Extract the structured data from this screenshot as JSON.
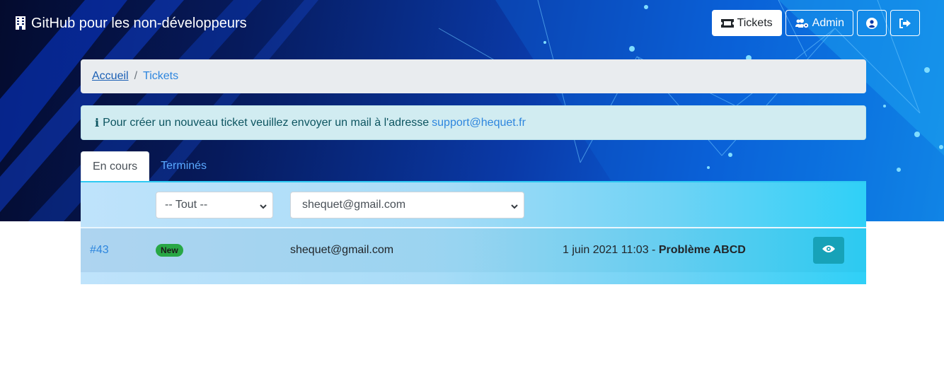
{
  "navbar": {
    "brand_text": "GitHub pour les non-développeurs",
    "tickets_label": "Tickets",
    "admin_label": "Admin"
  },
  "breadcrumb": {
    "home": "Accueil",
    "current": "Tickets"
  },
  "alert": {
    "text": "Pour créer un nouveau ticket veuillez envoyer un mail à l'adresse",
    "email": "support@hequet.fr"
  },
  "tabs": [
    {
      "label": "En cours",
      "active": true
    },
    {
      "label": "Terminés",
      "active": false
    }
  ],
  "filters": {
    "status_selected": "-- Tout --",
    "email_selected": "shequet@gmail.com"
  },
  "tickets": [
    {
      "id": "#43",
      "status": "New",
      "email": "shequet@gmail.com",
      "date": "1 juin 2021 11:03",
      "separator": " - ",
      "subject": "Problème ABCD"
    }
  ],
  "icons": {
    "brand": "building-icon",
    "tickets": "ticket-icon",
    "admin": "users-cog-icon",
    "profile": "user-circle-icon",
    "logout": "sign-out-icon",
    "info": "info-icon",
    "view": "eye-icon",
    "select_arrow": "chevron-down-icon"
  },
  "colors": {
    "accent": "#2e86de",
    "badge_new": "#28a745",
    "view_button": "#17a2b8",
    "alert_bg": "#d1ecf1"
  }
}
